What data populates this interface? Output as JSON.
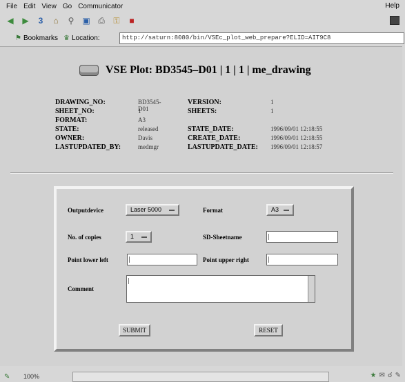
{
  "menu": {
    "items": [
      "File",
      "Edit",
      "View",
      "Go",
      "Communicator"
    ],
    "help": "Help"
  },
  "toolbar": {
    "icons": [
      "back-icon",
      "forward-icon",
      "reload-icon",
      "home-icon",
      "search-icon",
      "netscape-icon",
      "print-icon",
      "security-icon",
      "stop-icon"
    ]
  },
  "location_bar": {
    "bookmarks_label": "Bookmarks",
    "location_label": "Location:",
    "url": "http://saturn:8080/bin/VSEc_plot_web_prepare?ELID=AIT9C8"
  },
  "page": {
    "title": "VSE Plot: BD3545–D01 | 1 | 1 | me_drawing"
  },
  "info": [
    {
      "k1": "DRAWING_NO:",
      "v1": "BD3545-D01",
      "k2": "VERSION:",
      "v2": "1"
    },
    {
      "k1": "SHEET_NO:",
      "v1": "1",
      "k2": "SHEETS:",
      "v2": "1"
    },
    {
      "k1": "FORMAT:",
      "v1": "A3",
      "k2": "",
      "v2": ""
    },
    {
      "k1": "STATE:",
      "v1": "released",
      "k2": "STATE_DATE:",
      "v2": "1996/09/01 12:18:55"
    },
    {
      "k1": "OWNER:",
      "v1": "Davis",
      "k2": "CREATE_DATE:",
      "v2": "1996/09/01 12:18:55"
    },
    {
      "k1": "LASTUPDATED_BY:",
      "v1": "medmgr",
      "k2": "LASTUPDATE_DATE:",
      "v2": "1996/09/01 12:18:57"
    }
  ],
  "form": {
    "output_device_label": "Outputdevice",
    "output_device_value": "Laser 5000",
    "format_label": "Format",
    "format_value": "A3",
    "copies_label": "No. of copies",
    "copies_value": "1",
    "sd_sheetname_label": "SD-Sheetname",
    "point_lower_left_label": "Point lower left",
    "point_upper_right_label": "Point upper right",
    "comment_label": "Comment",
    "submit_label": "SUBMIT",
    "reset_label": "RESET"
  },
  "status": {
    "zoom": "100%"
  }
}
